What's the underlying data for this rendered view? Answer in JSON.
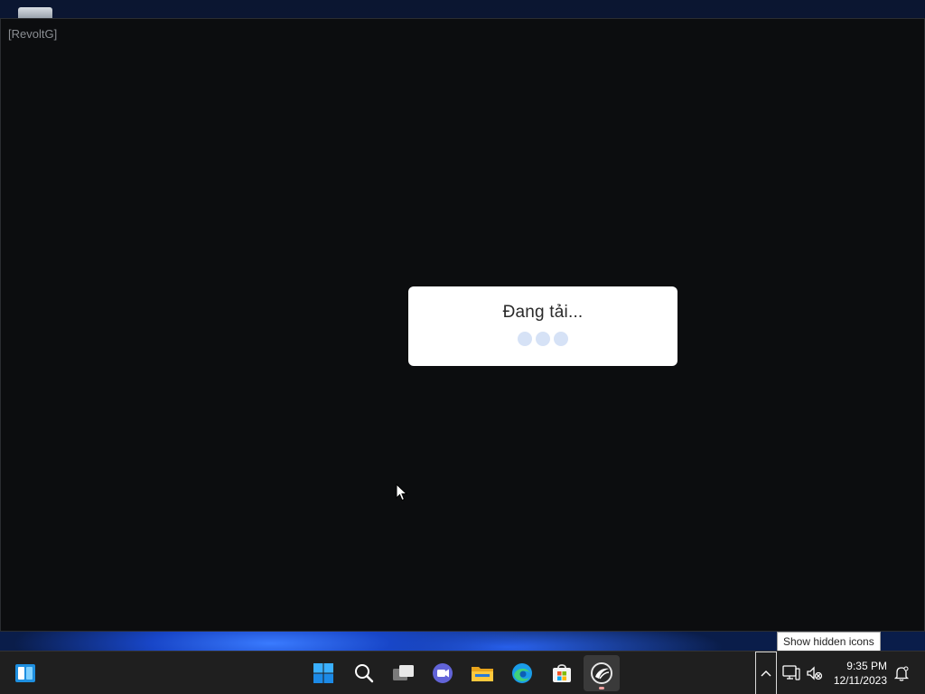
{
  "window": {
    "title": "[RevoltG]"
  },
  "dialog": {
    "loading_text": "Đang tải..."
  },
  "taskbar": {
    "pinned": [
      {
        "name": "Start",
        "icon": "windows-logo-icon"
      },
      {
        "name": "Search",
        "icon": "search-icon"
      },
      {
        "name": "Task View",
        "icon": "task-view-icon"
      },
      {
        "name": "Chat",
        "icon": "teams-chat-icon"
      },
      {
        "name": "File Explorer",
        "icon": "folder-icon"
      },
      {
        "name": "Microsoft Edge",
        "icon": "edge-icon"
      },
      {
        "name": "Microsoft Store",
        "icon": "store-icon"
      },
      {
        "name": "RevoltG",
        "icon": "revoltg-app-icon",
        "active": true
      }
    ],
    "widgets_icon": "widgets-icon"
  },
  "tray": {
    "chevron_icon": "chevron-up-icon",
    "network_icon": "network-icon",
    "volume_icon": "volume-muted-icon",
    "notification_icon": "notification-bell-icon",
    "time": "9:35 PM",
    "date": "12/11/2023",
    "tooltip": "Show hidden icons"
  },
  "colors": {
    "app_background": "#0c0d0f",
    "dialog_background": "#ffffff",
    "loading_dot": "#d6e2f6",
    "taskbar": "#1f1f1f"
  }
}
